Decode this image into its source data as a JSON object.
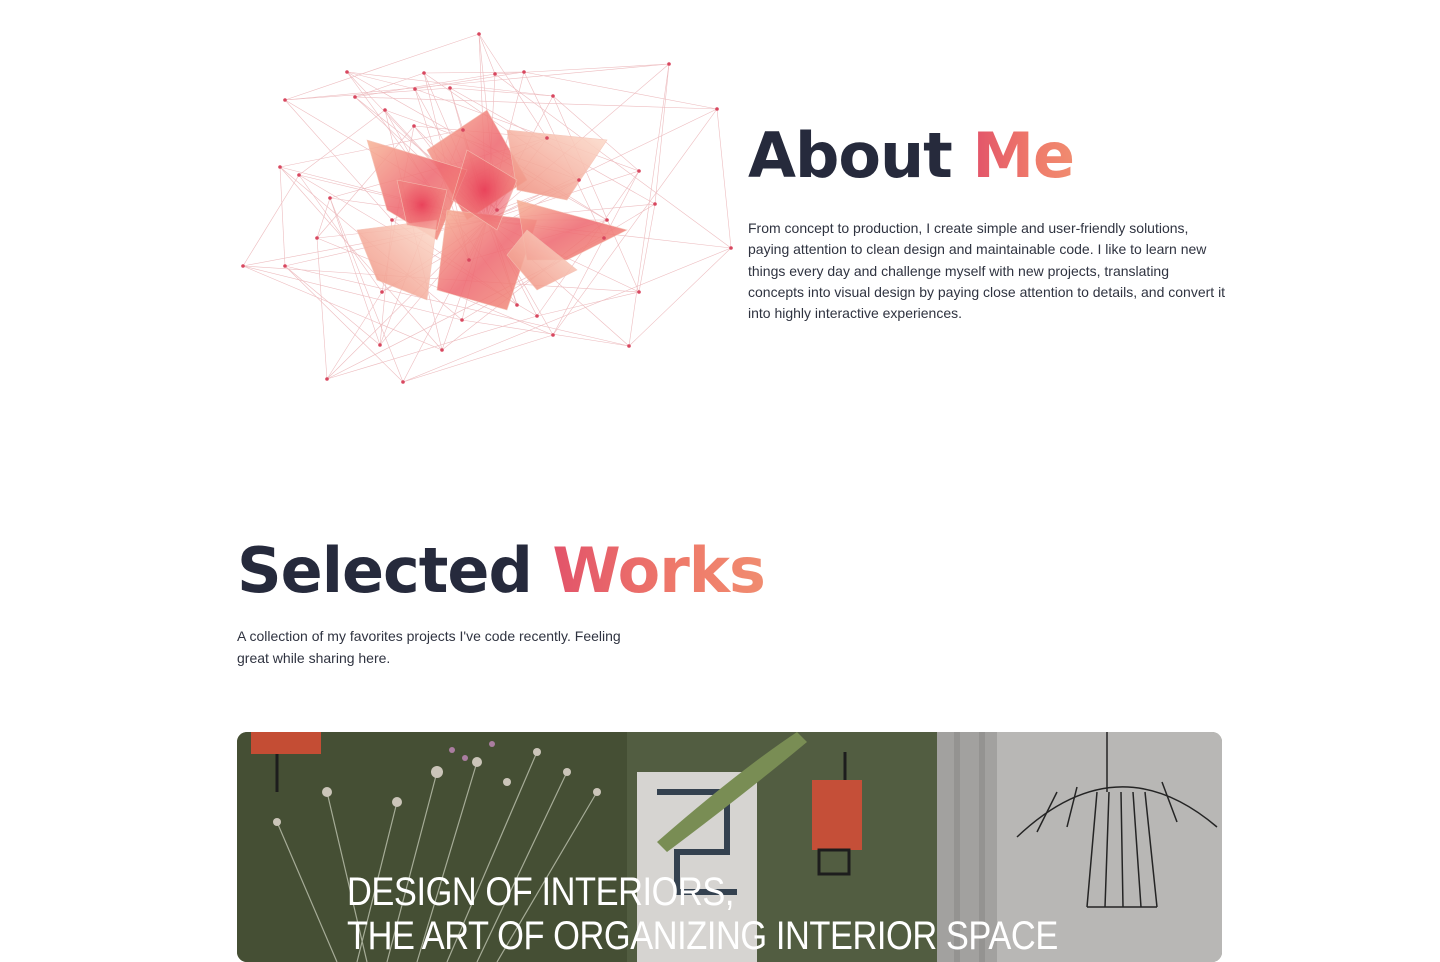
{
  "about": {
    "title_dark": "About",
    "title_accent": "Me",
    "description": "From concept to production, I create simple and user-friendly solutions, paying attention to clean design and maintainable code. I like to learn new things every day and challenge myself with new projects, translating concepts into visual design by paying close attention to details, and convert it into highly interactive experiences."
  },
  "works": {
    "title_dark": "Selected",
    "title_accent": "Works",
    "description": "A collection of my favorites projects I've code recently. Feeling great while sharing here.",
    "featured": {
      "caption_line1": "DESIGN OF INTERIORS,",
      "caption_line2": "THE ART OF ORGANIZING INTERIOR SPACE"
    }
  },
  "colors": {
    "heading_dark": "#262a3c",
    "accent_start": "#e2536a",
    "accent_end": "#f08c70",
    "body_text": "#2f3340"
  }
}
